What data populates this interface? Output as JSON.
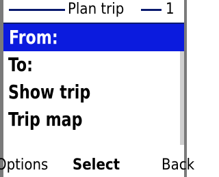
{
  "title": {
    "text": "Plan trip",
    "page_number": "1"
  },
  "menu": {
    "items": [
      {
        "label": "From:"
      },
      {
        "label": "To:"
      },
      {
        "label": "Show trip"
      },
      {
        "label": "Trip map"
      }
    ],
    "selected_index": 0
  },
  "softkeys": {
    "left": "Options",
    "center": "Select",
    "right": "Back"
  },
  "colors": {
    "selection": "#0b1bde",
    "title_line": "#0a1a6e",
    "frame": "#7a7a7a"
  }
}
